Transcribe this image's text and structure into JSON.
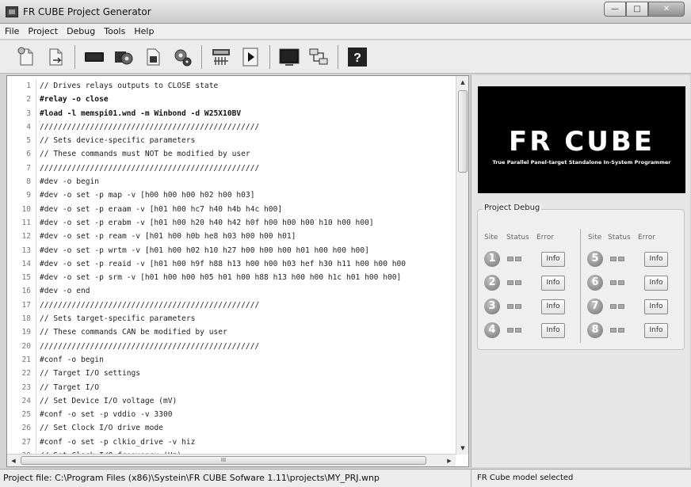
{
  "window": {
    "title": "FR CUBE Project Generator"
  },
  "menu": [
    "File",
    "Project",
    "Debug",
    "Tools",
    "Help"
  ],
  "toolbar": {
    "icons": [
      "new-project-icon",
      "open-project-icon",
      "device-icon",
      "settings-gear-icon",
      "configuration-icon",
      "build-icon",
      "programmer-icon",
      "run-icon",
      "terminal-icon",
      "network-icon",
      "help-icon"
    ],
    "help_label": "?"
  },
  "editor": {
    "lines": [
      {
        "n": "1",
        "t": "// Drives relays outputs to CLOSE state",
        "cmd": false
      },
      {
        "n": "2",
        "t": "#relay -o close",
        "cmd": true
      },
      {
        "n": "3",
        "t": "#load -l memspi01.wnd -m Winbond -d W25X10BV",
        "cmd": true
      },
      {
        "n": "4",
        "t": "////////////////////////////////////////////////",
        "cmd": false
      },
      {
        "n": "5",
        "t": "// Sets device-specific parameters",
        "cmd": false
      },
      {
        "n": "6",
        "t": "// These commands must NOT be modified by user",
        "cmd": false
      },
      {
        "n": "7",
        "t": "////////////////////////////////////////////////",
        "cmd": false
      },
      {
        "n": "8",
        "t": "#dev -o begin",
        "cmd": false
      },
      {
        "n": "9",
        "t": "#dev -o set -p map -v [h00 h00 h00 h02 h00 h03]",
        "cmd": false
      },
      {
        "n": "10",
        "t": "#dev -o set -p eraam -v [h01 h00 hc7 h40 h4b h4c h00]",
        "cmd": false
      },
      {
        "n": "11",
        "t": "#dev -o set -p erabm -v [h01 h00 h20 h40 h42 h0f h00 h00 h00 h10 h00 h00]",
        "cmd": false
      },
      {
        "n": "12",
        "t": "#dev -o set -p ream -v [h01 h00 h0b he8 h03 h00 h00 h01]",
        "cmd": false
      },
      {
        "n": "13",
        "t": "#dev -o set -p wrtm -v [h01 h00 h02 h10 h27 h00 h00 h00 h01 h00 h00 h00]",
        "cmd": false
      },
      {
        "n": "14",
        "t": "#dev -o set -p reaid -v [h01 h00 h9f h88 h13 h00 h00 h03 hef h30 h11 h00 h00 h00",
        "cmd": false
      },
      {
        "n": "15",
        "t": "#dev -o set -p srm -v [h01 h00 h00 h05 h01 h00 h88 h13 h00 h00 h1c h01 h00 h00]",
        "cmd": false
      },
      {
        "n": "16",
        "t": "#dev -o end",
        "cmd": false
      },
      {
        "n": "17",
        "t": "////////////////////////////////////////////////",
        "cmd": false
      },
      {
        "n": "18",
        "t": "// Sets target-specific parameters",
        "cmd": false
      },
      {
        "n": "19",
        "t": "// These commands CAN be modified by user",
        "cmd": false
      },
      {
        "n": "20",
        "t": "////////////////////////////////////////////////",
        "cmd": false
      },
      {
        "n": "21",
        "t": "#conf -o begin",
        "cmd": false
      },
      {
        "n": "22",
        "t": "// Target I/O settings",
        "cmd": false
      },
      {
        "n": "23",
        "t": "// Target I/O",
        "cmd": false
      },
      {
        "n": "24",
        "t": "// Set Device I/O voltage (mV)",
        "cmd": false
      },
      {
        "n": "25",
        "t": "#conf -o set -p vddio -v 3300",
        "cmd": false
      },
      {
        "n": "26",
        "t": "// Set Clock I/O drive mode",
        "cmd": false
      },
      {
        "n": "27",
        "t": "#conf -o set -p clkio_drive -v hiz",
        "cmd": false
      },
      {
        "n": "28",
        "t": "// Set Clock I/O frequency (Hz)",
        "cmd": false
      }
    ],
    "hscroll_grip": "III"
  },
  "logo": {
    "name": "FR CUBE",
    "tagline": "True Parallel Panel-target Standalone In-System Programmer"
  },
  "debug": {
    "title": "Project Debug",
    "headers": [
      "Site",
      "Status",
      "Error"
    ],
    "sites": [
      {
        "num": "1",
        "info": "Info"
      },
      {
        "num": "2",
        "info": "Info"
      },
      {
        "num": "3",
        "info": "Info"
      },
      {
        "num": "4",
        "info": "Info"
      },
      {
        "num": "5",
        "info": "Info"
      },
      {
        "num": "6",
        "info": "Info"
      },
      {
        "num": "7",
        "info": "Info"
      },
      {
        "num": "8",
        "info": "Info"
      }
    ]
  },
  "status": {
    "project_file": "Project file: C:\\Program Files (x86)\\Systein\\FR CUBE Sofware 1.11\\projects\\MY_PRJ.wnp",
    "model": "FR Cube model selected"
  }
}
